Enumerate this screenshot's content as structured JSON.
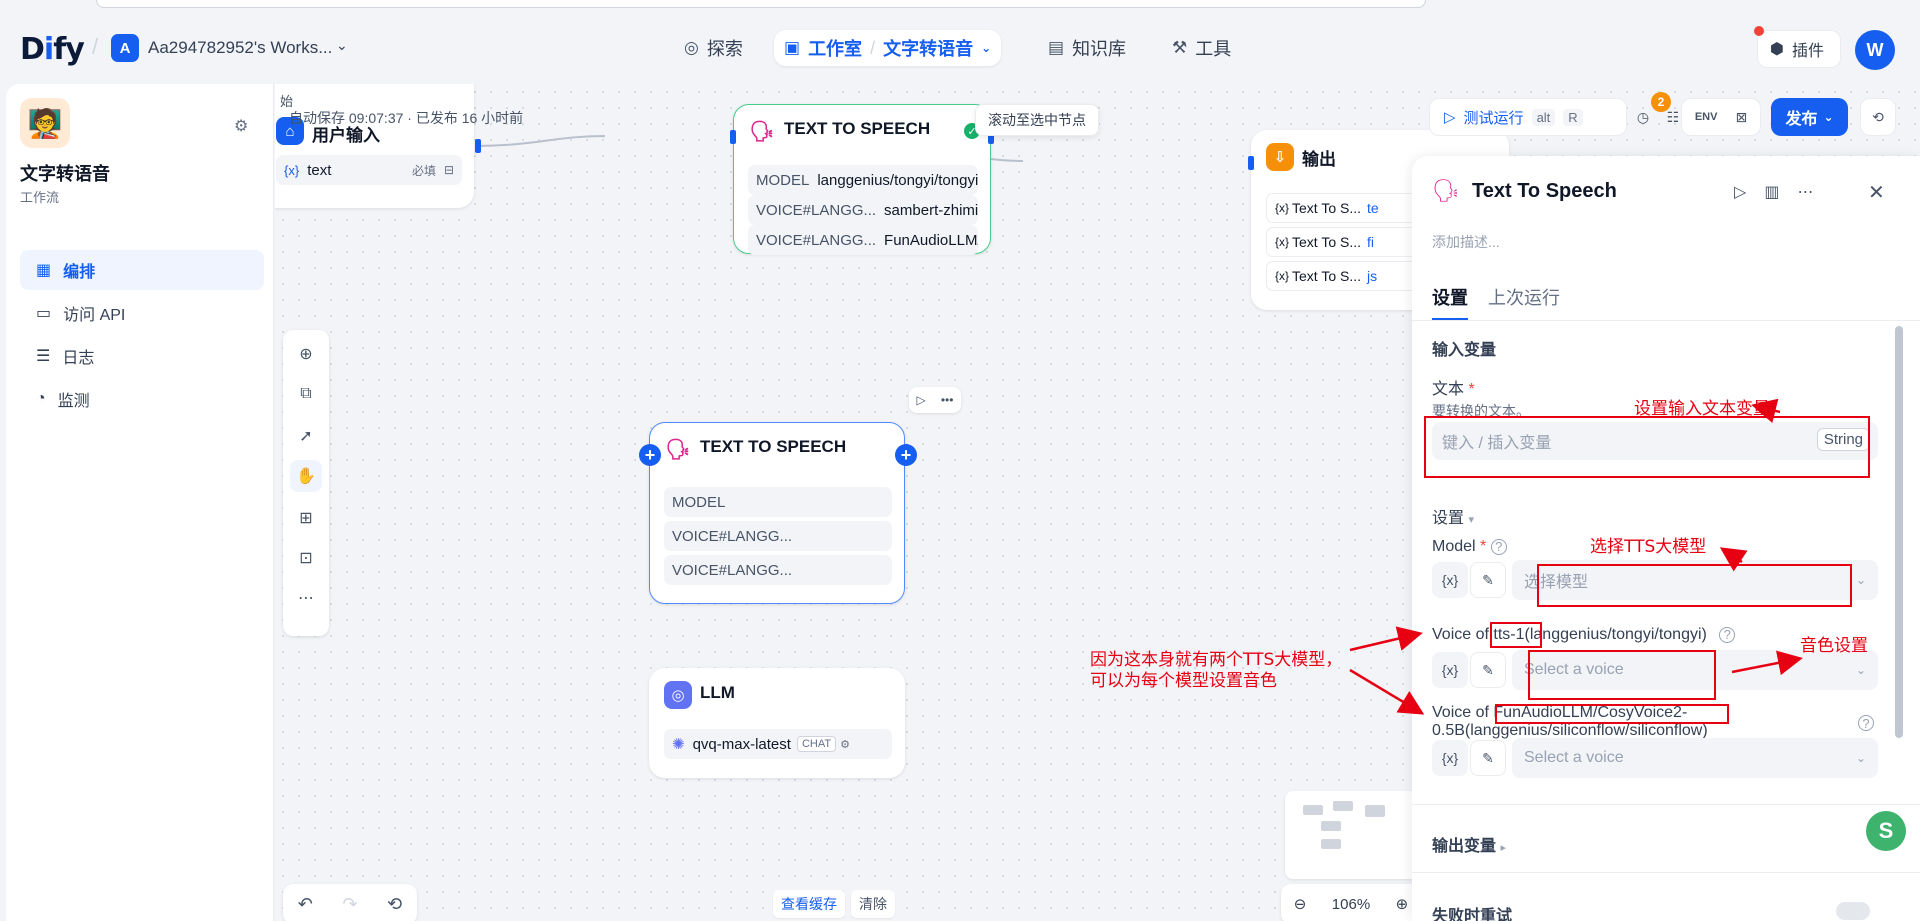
{
  "header": {
    "logo": "Dify",
    "workspace_initial": "A",
    "workspace_name": "Aa294782952's Works...",
    "nav": {
      "explore": "探索",
      "studio": "工作室",
      "studio_sub": "文字转语音",
      "knowledge": "知识库",
      "tools": "工具"
    },
    "plugins": "插件",
    "user_initial": "W"
  },
  "sidebar": {
    "app_name": "文字转语音",
    "app_type": "工作流",
    "items": [
      {
        "label": "编排",
        "icon": "layout-icon"
      },
      {
        "label": "访问 API",
        "icon": "terminal-icon"
      },
      {
        "label": "日志",
        "icon": "file-text-icon"
      },
      {
        "label": "监测",
        "icon": "gauge-icon"
      }
    ]
  },
  "canvas": {
    "partial_label": "始",
    "autosave": "自动保存 09:07:37 · 已发布 16 小时前",
    "scroll_tooltip": "滚动至选中节点",
    "cache": {
      "view": "查看缓存",
      "clear": "清除"
    },
    "zoom": "106%",
    "user_input_node": {
      "title": "用户输入",
      "var_prefix": "{x}",
      "var_name": "text",
      "required": "必填"
    },
    "tts_node_1": {
      "title": "TEXT TO SPEECH",
      "rows": [
        {
          "key": "MODEL",
          "value": "langgenius/tongyi/tongyi..."
        },
        {
          "key": "VOICE#LANGG...",
          "value": "sambert-zhimin..."
        },
        {
          "key": "VOICE#LANGG...",
          "value": "FunAudioLLM/..."
        }
      ]
    },
    "output_node": {
      "title": "输出",
      "rows": [
        "Text To S...",
        "Text To S...",
        "Text To S..."
      ],
      "tail": [
        "te",
        "fi",
        "js"
      ]
    },
    "tts_node_2": {
      "title": "TEXT TO SPEECH",
      "rows": [
        "MODEL",
        "VOICE#LANGG...",
        "VOICE#LANGG..."
      ]
    },
    "llm_node": {
      "title": "LLM",
      "model": "qvq-max-latest",
      "mode": "CHAT"
    }
  },
  "topbar": {
    "run_label": "测试运行",
    "run_kbd_1": "alt",
    "run_kbd_2": "R",
    "badge": "2",
    "env": "ENV",
    "publish": "发布"
  },
  "panel": {
    "title": "Text To Speech",
    "description_placeholder": "添加描述...",
    "tabs": [
      "设置",
      "上次运行"
    ],
    "input_section": "输入变量",
    "text_label": "文本",
    "text_hint": "要转换的文本。",
    "text_placeholder": "键入 / 插入变量",
    "string_tag": "String",
    "settings_section": "设置",
    "model_label": "Model",
    "model_placeholder": "选择模型",
    "voice1_prefix": "Voice of",
    "voice1_model": "tts-1(langgenius/tongyi/tongyi)",
    "voice1_placeholder": "Select a voice",
    "voice2_prefix": "Voice of",
    "voice2_model": "FunAudioLLM/CosyVoice2-",
    "voice2_model_2": "0.5B(langgenius/siliconflow/siliconflow)",
    "voice2_placeholder": "Select a voice",
    "var_icon": "{x}",
    "output_section": "输出变量",
    "retry_section": "失败时重试"
  },
  "annotations": {
    "set_input": "设置输入文本变量",
    "select_tts": "选择TTS大模型",
    "voice_setting": "音色设置",
    "two_models_1": "因为这本身就有两个TTS大模型，",
    "two_models_2": "可以为每个模型设置音色"
  },
  "colors": {
    "accent": "#155eef",
    "annotation": "#e60012",
    "tts_icon": "#dd2590",
    "output_icon": "#f79009",
    "llm_icon": "#6172f3"
  }
}
